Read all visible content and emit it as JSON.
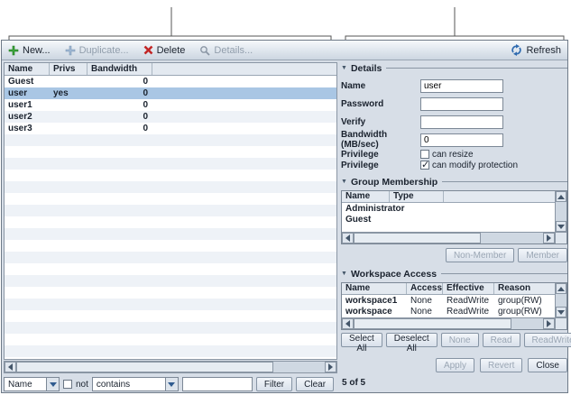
{
  "ui": {
    "collapse_glyph": "▼"
  },
  "toolbar": {
    "new_label": "New...",
    "duplicate_label": "Duplicate...",
    "delete_label": "Delete",
    "details_label": "Details...",
    "refresh_label": "Refresh"
  },
  "user_table": {
    "columns": [
      "Name",
      "Privs",
      "Bandwidth"
    ],
    "rows": [
      {
        "name": "Guest",
        "privs": "",
        "bandwidth": "0",
        "selected": false
      },
      {
        "name": "user",
        "privs": "yes",
        "bandwidth": "0",
        "selected": true
      },
      {
        "name": "user1",
        "privs": "",
        "bandwidth": "0",
        "selected": false
      },
      {
        "name": "user2",
        "privs": "",
        "bandwidth": "0",
        "selected": false
      },
      {
        "name": "user3",
        "privs": "",
        "bandwidth": "0",
        "selected": false
      }
    ]
  },
  "filter_bar": {
    "field": "Name",
    "not_label": "not",
    "not_checked": false,
    "operator": "contains",
    "value": "",
    "filter_label": "Filter",
    "clear_label": "Clear",
    "count": "5 of 5"
  },
  "details": {
    "title": "Details",
    "fields": [
      {
        "label": "Name",
        "value": "user"
      },
      {
        "label": "Password",
        "value": ""
      },
      {
        "label": "Verify",
        "value": ""
      },
      {
        "label": "Bandwidth (MB/sec)",
        "value": "0"
      }
    ],
    "privilege_label": "Privilege",
    "privileges": [
      {
        "label": "can resize",
        "checked": false
      },
      {
        "label": "can modify protection",
        "checked": true
      }
    ]
  },
  "group_membership": {
    "title": "Group Membership",
    "columns": [
      "Name",
      "Type"
    ],
    "rows": [
      {
        "name": "Administrator",
        "type": ""
      },
      {
        "name": "Guest",
        "type": ""
      }
    ],
    "non_member_label": "Non-Member",
    "member_label": "Member"
  },
  "workspace_access": {
    "title": "Workspace Access",
    "columns": [
      "Name",
      "Access",
      "Effective",
      "Reason"
    ],
    "rows": [
      {
        "name": "workspace1",
        "access": "None",
        "effective": "ReadWrite",
        "reason": "group(RW)"
      },
      {
        "name": "workspace",
        "access": "None",
        "effective": "ReadWrite",
        "reason": "group(RW)"
      }
    ],
    "select_all_label": "Select All",
    "deselect_all_label": "Deselect All",
    "none_label": "None",
    "read_label": "Read",
    "readwrite_label": "ReadWrite"
  },
  "footer": {
    "apply_label": "Apply",
    "revert_label": "Revert",
    "close_label": "Close"
  }
}
